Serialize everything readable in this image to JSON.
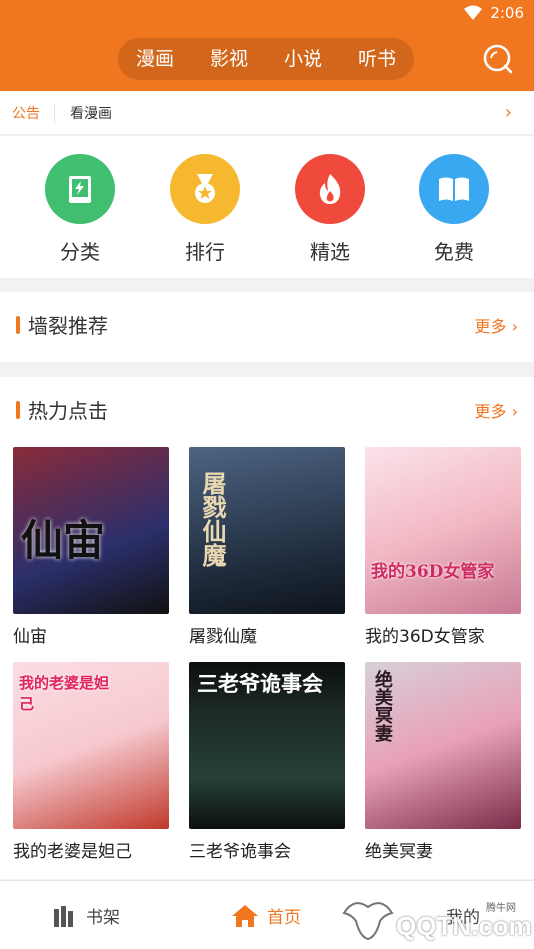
{
  "status": {
    "time": "2:06"
  },
  "tabs": [
    {
      "label": "漫画",
      "active": true
    },
    {
      "label": "影视",
      "active": false
    },
    {
      "label": "小说",
      "active": false
    },
    {
      "label": "听书",
      "active": false
    }
  ],
  "notice": {
    "tag": "公告",
    "text": "看漫画"
  },
  "shortcuts": [
    {
      "label": "分类",
      "color": "#3fbf6f",
      "icon": "book-lightning-icon"
    },
    {
      "label": "排行",
      "color": "#f5b82e",
      "icon": "medal-icon"
    },
    {
      "label": "精选",
      "color": "#f04a3d",
      "icon": "flame-icon"
    },
    {
      "label": "免费",
      "color": "#3aa8f0",
      "icon": "open-book-icon"
    }
  ],
  "sections": {
    "recommend": {
      "title": "墙裂推荐",
      "more": "更多"
    },
    "hot": {
      "title": "热力点击",
      "more": "更多"
    }
  },
  "comics": [
    {
      "title": "仙宙",
      "cover_text": "仙宙",
      "color": "#8a2b3a",
      "color2": "#2b2f6b"
    },
    {
      "title": "屠戮仙魔",
      "cover_text": "屠戮仙魔",
      "color": "#3c4f6a",
      "color2": "#1e2a3a"
    },
    {
      "title": "我的36D女管家",
      "cover_text": "我的36D女管家",
      "color": "#f2b8c4",
      "color2": "#c77a92"
    },
    {
      "title": "我的老婆是妲己",
      "cover_text": "我的老婆是妲己",
      "color": "#f6c9cf",
      "color2": "#c0392b"
    },
    {
      "title": "三老爷诡事会",
      "cover_text": "三老爷诡事会",
      "color": "#1d2a26",
      "color2": "#0b0f0e"
    },
    {
      "title": "绝美冥妻",
      "cover_text": "绝美冥妻",
      "color": "#e8a0b8",
      "color2": "#7a2d4a"
    }
  ],
  "nav": [
    {
      "label": "书架",
      "active": false
    },
    {
      "label": "首页",
      "active": true
    },
    {
      "label": "我的",
      "active": false
    }
  ],
  "watermark": {
    "text": "QQTN.com",
    "small": "腾牛网"
  },
  "colors": {
    "accent": "#f0761f"
  }
}
